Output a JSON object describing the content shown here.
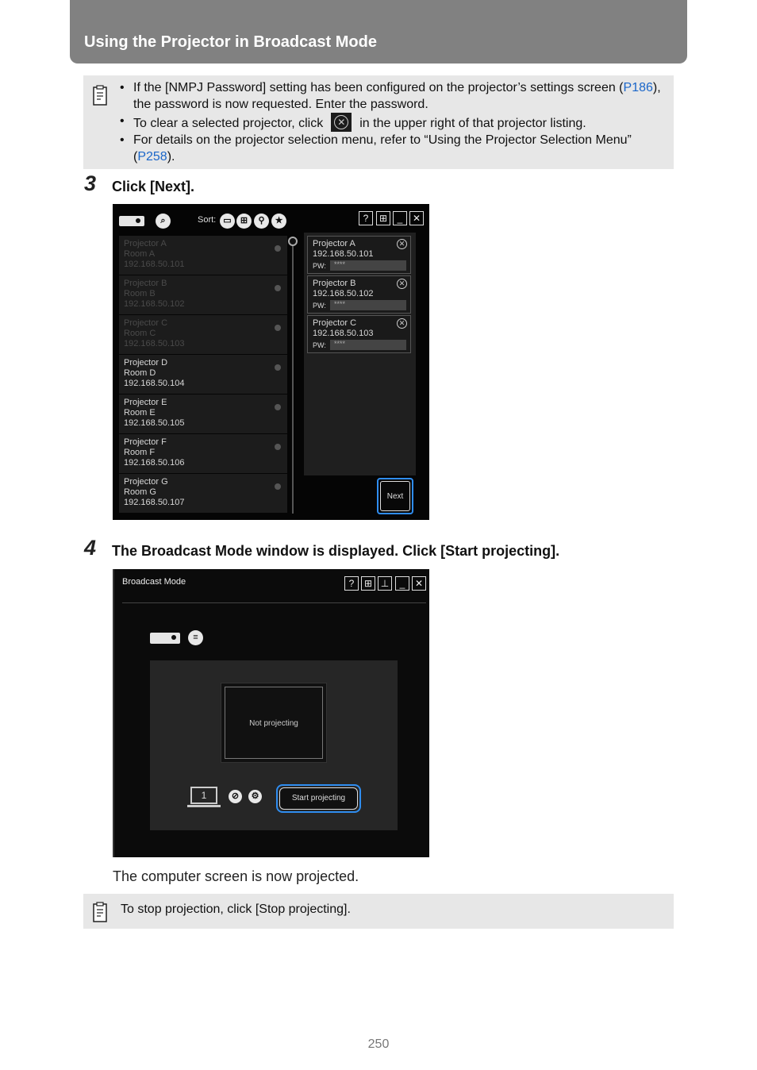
{
  "header": {
    "title": "Using the Projector in Broadcast Mode"
  },
  "note1": {
    "b1_pre": "If the [NMPJ Password] setting has been configured on the projector’s settings screen (",
    "b1_link": "P186",
    "b1_post": "), the password is now requested. Enter the password.",
    "b2_pre": "To clear a selected projector, click",
    "b2_post": "in the upper right of that projector listing.",
    "b3_pre": "For details on the projector selection menu, refer to “Using the Projector Selection Menu” (",
    "b3_link": "P258",
    "b3_post": ")."
  },
  "step3": {
    "number": "3",
    "text": "Click [Next]."
  },
  "shot1": {
    "sort_label": "Sort:",
    "window_buttons": [
      "?",
      "⊞",
      "_",
      "✕"
    ],
    "projectors": [
      {
        "name": "Projector A",
        "room": "Room A",
        "ip": "192.168.50.101"
      },
      {
        "name": "Projector B",
        "room": "Room B",
        "ip": "192.168.50.102"
      },
      {
        "name": "Projector C",
        "room": "Room C",
        "ip": "192.168.50.103"
      },
      {
        "name": "Projector D",
        "room": "Room D",
        "ip": "192.168.50.104"
      },
      {
        "name": "Projector E",
        "room": "Room E",
        "ip": "192.168.50.105"
      },
      {
        "name": "Projector F",
        "room": "Room F",
        "ip": "192.168.50.106"
      },
      {
        "name": "Projector G",
        "room": "Room G",
        "ip": "192.168.50.107"
      }
    ],
    "selected": [
      {
        "name": "Projector A",
        "ip": "192.168.50.101",
        "pw_label": "PW:",
        "pw_value": "****"
      },
      {
        "name": "Projector B",
        "ip": "192.168.50.102",
        "pw_label": "PW:",
        "pw_value": "****"
      },
      {
        "name": "Projector C",
        "ip": "192.168.50.103",
        "pw_label": "PW:",
        "pw_value": "****"
      }
    ],
    "next_label": "Next"
  },
  "step4": {
    "number": "4",
    "text": "The Broadcast Mode window is displayed. Click [Start projecting]."
  },
  "shot2": {
    "title": "Broadcast Mode",
    "window_buttons": [
      "?",
      "⊞",
      "⊥",
      "_",
      "✕"
    ],
    "preview_text": "Not projecting",
    "monitor_number": "1",
    "start_label": "Start projecting"
  },
  "caption": "The computer screen is now projected.",
  "note2": {
    "text": "To stop projection, click [Stop projecting]."
  },
  "page_number": "250"
}
